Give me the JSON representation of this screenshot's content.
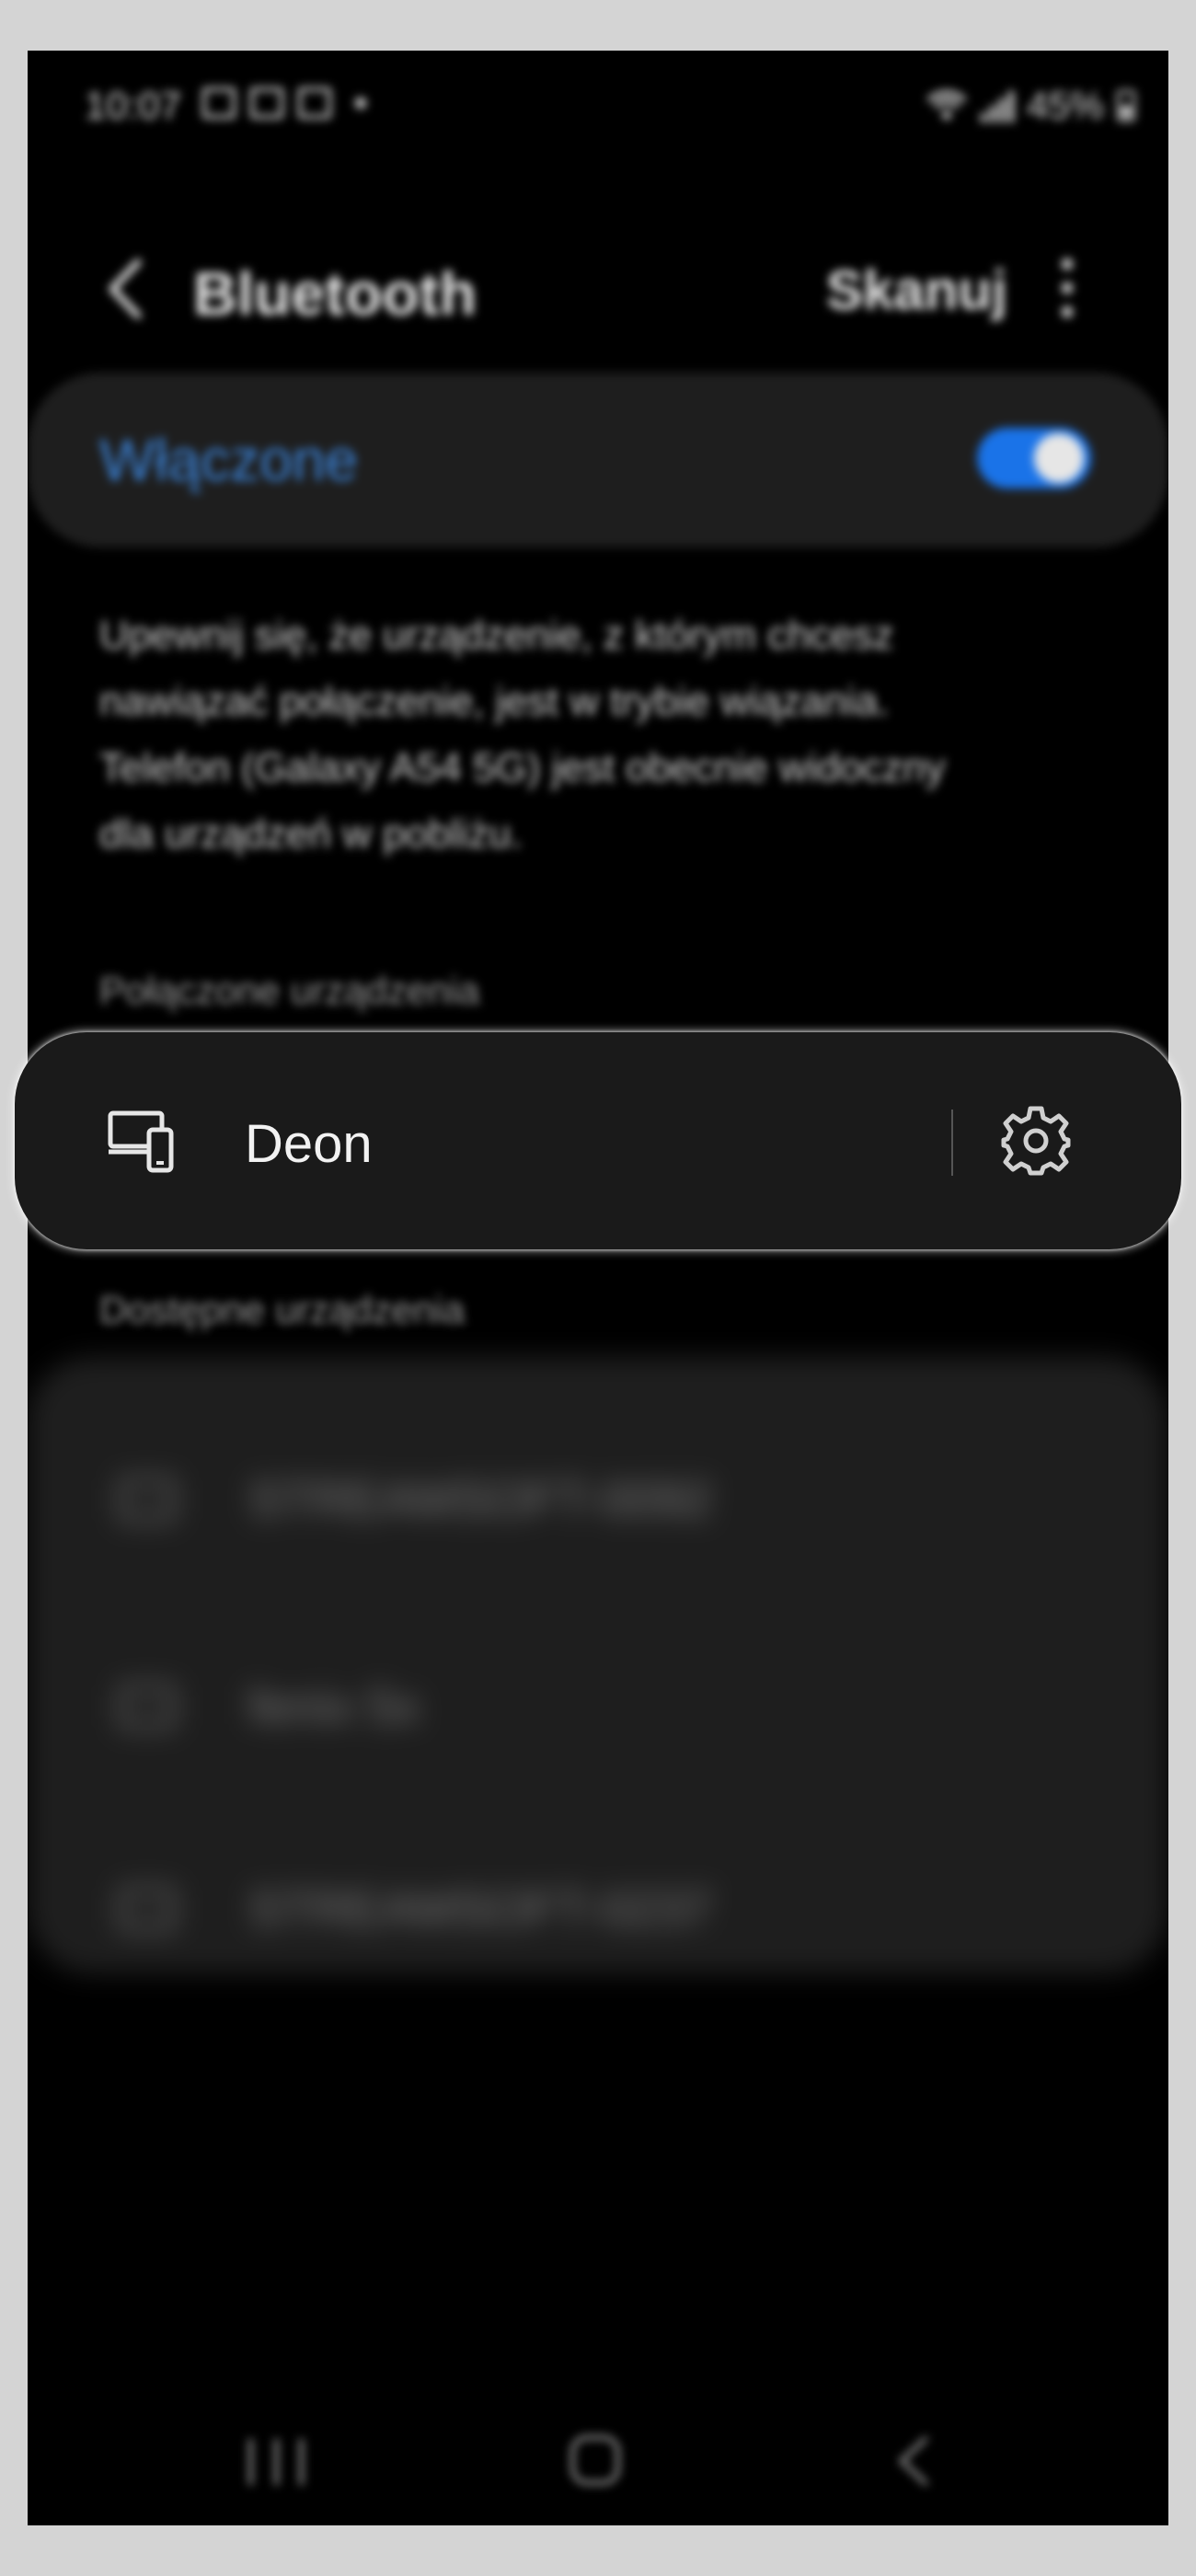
{
  "status": {
    "time": "10:07",
    "battery": "45%"
  },
  "appbar": {
    "title": "Bluetooth",
    "scan_label": "Skanuj"
  },
  "bluetooth_toggle": {
    "label": "Włączone",
    "on": true,
    "accent": "#1a73e8"
  },
  "description": "Upewnij się, że urządzenie, z którym chcesz\nnawiązać połączenie, jest w trybie wiązania.\nTelefon (Galaxy A54 5G) jest obecnie widoczny\ndla urządzeń w pobliżu.",
  "connected": {
    "header": "Połączone urządzenia",
    "device_name": "Deon"
  },
  "available": {
    "header": "Dostępne urządzenia",
    "items": [
      {
        "name": "STREAMSOFT-0092",
        "icon": "laptop-icon"
      },
      {
        "name": "fenix 5x",
        "icon": "devices-icon"
      },
      {
        "name": "STREAMSOFT-0237",
        "icon": "laptop-icon"
      }
    ]
  }
}
